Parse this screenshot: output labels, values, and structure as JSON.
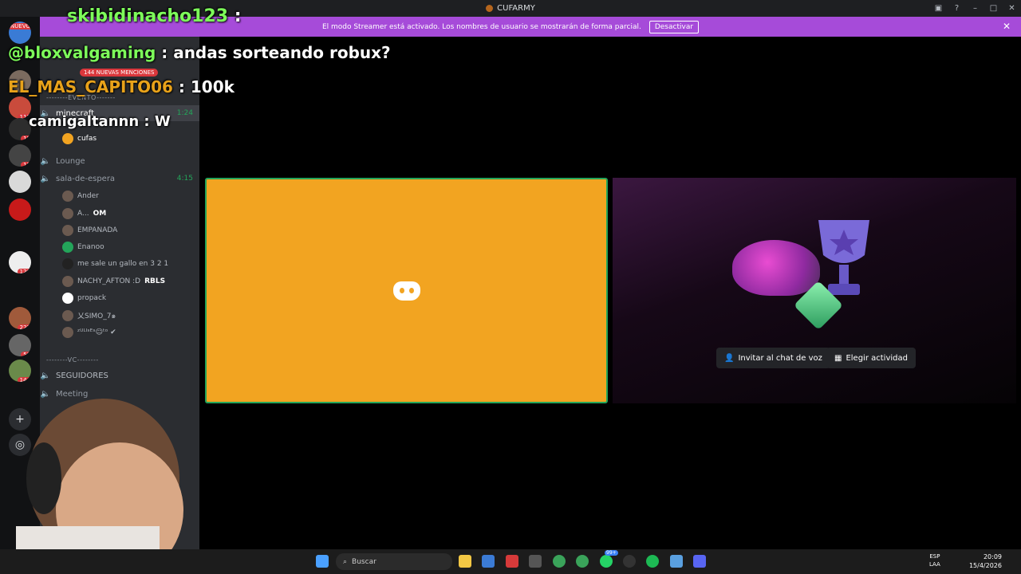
{
  "window": {
    "title": "CUFARMY"
  },
  "streamer_banner": {
    "text": "El modo Streamer está activado. Los nombres de usuario se mostrarán de forma parcial.",
    "button": "Desactivar"
  },
  "overlay_chat": [
    {
      "user": "skibidinacho123",
      "message": ":",
      "color": "#7dfc5a"
    },
    {
      "user": "@bloxvalgaming",
      "message": ": andas sorteando robux?",
      "color": "#7dfc5a"
    },
    {
      "user": "EL_MAS_CAPITO06",
      "message": ": 100k",
      "color": "#e8a21a"
    },
    {
      "user": "camigaltannn",
      "message": ": W",
      "color": "#ffffff"
    }
  ],
  "guild_badges": {
    "new": "NUEVO",
    "b1": "117",
    "b2": "19",
    "b3": "12",
    "b4": "120",
    "b5": "227",
    "b6": "50",
    "b7": "144"
  },
  "sidebar": {
    "mentions": "144 NUEVAS MENCIONES",
    "cat_evento": "--------EVENTO-------",
    "ch_minecraft": "minecraft",
    "ch_minecraft_time": "1:24",
    "u_cufas": "cufas",
    "ch_lounge": "Lounge",
    "ch_sala": "sala-de-espera",
    "ch_sala_time": "4:15",
    "u_ander": "Ander",
    "u_a": "A...",
    "u_a_tag": "OM",
    "u_empanada": "EMPANADA",
    "u_enanoo": "Enanoo",
    "u_gallo": "me sale un gallo en 3 2 1",
    "u_nachy": "NACHY_AFTON :D",
    "u_nachy_tag": "RBLS",
    "u_propack": "propack",
    "u_simo": "乂SIMO_7๑",
    "u_ulises": "ᶻᵁᴸᴵˢᴱˢ☺ᵗᵒ ✔",
    "cat_vc": "--------VC--------",
    "ch_seguidores": "SEGUIDORES",
    "ch_meeting": "Meeting"
  },
  "activity": {
    "invite": "Invitar al chat de voz",
    "choose": "Elegir actividad"
  },
  "taskbar": {
    "search": "Buscar",
    "lang1": "ESP",
    "lang2": "LAA",
    "time": "20:09",
    "date": "15/4/2026",
    "badge": "99+"
  },
  "colors": {
    "tile": "#f2a421",
    "speaking": "#23a55a",
    "banner": "#a64bd9"
  }
}
